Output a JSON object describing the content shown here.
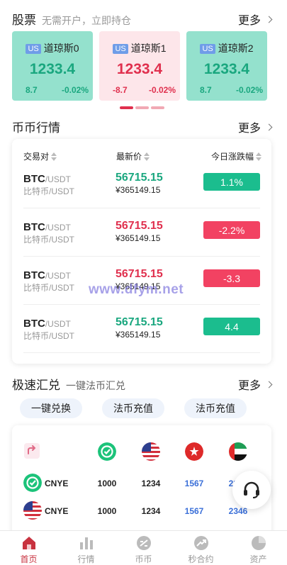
{
  "stocks": {
    "title": "股票",
    "subtitle": "无需开户，立即持仓",
    "more": "更多",
    "cards": [
      {
        "badge": "US",
        "name": "道琼斯0",
        "price": "1233.4",
        "change": "8.7",
        "percent": "-0.02%",
        "trend": "up"
      },
      {
        "badge": "US",
        "name": "道琼斯1",
        "price": "1233.4",
        "change": "-8.7",
        "percent": "-0.02%",
        "trend": "down"
      },
      {
        "badge": "US",
        "name": "道琼斯2",
        "price": "1233.4",
        "change": "8.7",
        "percent": "-0.02%",
        "trend": "up"
      }
    ]
  },
  "market": {
    "title": "币币行情",
    "more": "更多",
    "headers": {
      "pair": "交易对",
      "last": "最新价",
      "change": "今日涨跌幅"
    },
    "rows": [
      {
        "base": "BTC",
        "quote": "/USDT",
        "cn": "比特币/USDT",
        "last": "56715.15",
        "cny": "¥365149.15",
        "change": "1.1%",
        "trend": "up"
      },
      {
        "base": "BTC",
        "quote": "/USDT",
        "cn": "比特币/USDT",
        "last": "56715.15",
        "cny": "¥365149.15",
        "change": "-2.2%",
        "trend": "down"
      },
      {
        "base": "BTC",
        "quote": "/USDT",
        "cn": "比特币/USDT",
        "last": "56715.15",
        "cny": "¥365149.15",
        "change": "-3.3",
        "trend": "down"
      },
      {
        "base": "BTC",
        "quote": "/USDT",
        "cn": "比特币/USDT",
        "last": "56715.15",
        "cny": "¥365149.15",
        "change": "4.4",
        "trend": "up"
      }
    ]
  },
  "watermark": "www.dfym.net",
  "exchange": {
    "title": "极速汇兑",
    "subtitle": "一键法币汇兑",
    "more": "更多",
    "tabs": [
      "一键兑换",
      "法币充值",
      "法币充值"
    ],
    "rows": [
      {
        "label": "CNYE",
        "values": [
          "1000",
          "1234",
          "1567",
          "2346"
        ]
      },
      {
        "label": "CNYE",
        "values": [
          "1000",
          "1234",
          "1567",
          "2346"
        ]
      }
    ]
  },
  "tabbar": {
    "items": [
      {
        "label": "首页",
        "active": true
      },
      {
        "label": "行情",
        "active": false
      },
      {
        "label": "币币",
        "active": false
      },
      {
        "label": "秒合约",
        "active": false
      },
      {
        "label": "资产",
        "active": false
      }
    ]
  },
  "colors": {
    "up": "#1bbd8e",
    "down": "#f24262",
    "accent": "#c8323f"
  }
}
